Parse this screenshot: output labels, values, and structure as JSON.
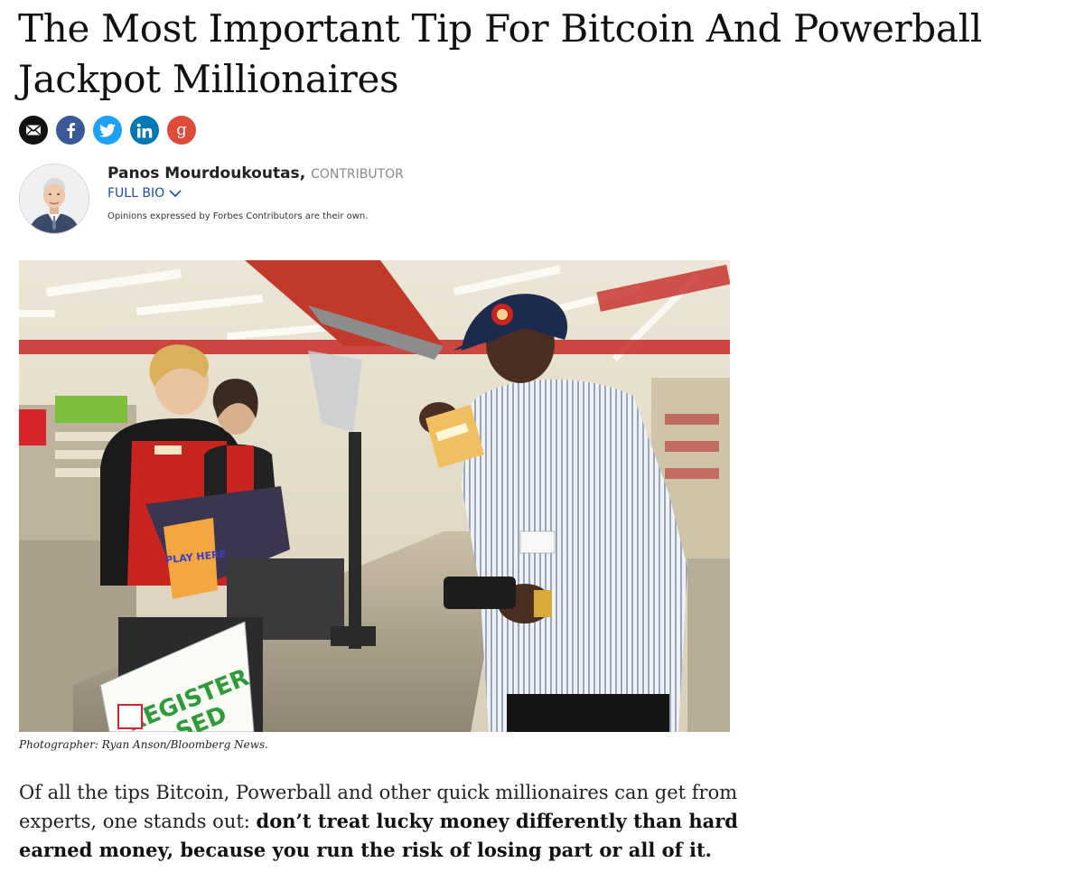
{
  "article": {
    "title": "The Most Important Tip For Bitcoin And Powerball Jackpot Millionaires"
  },
  "share": {
    "buttons": [
      {
        "icon": "email-icon",
        "color": "#111111"
      },
      {
        "icon": "facebook-icon",
        "color": "#3b5998"
      },
      {
        "icon": "twitter-icon",
        "color": "#1da1f2"
      },
      {
        "icon": "linkedin-icon",
        "color": "#0077b5"
      },
      {
        "icon": "google-plus-icon",
        "color": "#dd4b39"
      }
    ]
  },
  "author": {
    "name": "Panos Mourdoukoutas",
    "separator": ", ",
    "role": "CONTRIBUTOR",
    "bio_link": "FULL BIO",
    "disclaimer": "Opinions expressed by Forbes Contributors are their own."
  },
  "photo": {
    "sign_text": "PLAY HERE",
    "register_text": "REGISTER",
    "register_sub": "SED",
    "caption": "Photographer: Ryan Anson/Bloomberg News."
  },
  "body": {
    "intro": "Of all the tips Bitcoin, Powerball and other quick millionaires can get from experts, one stands out: ",
    "emphasis": "don’t treat lucky money differently than hard earned money, because you run the risk of losing part or all of it."
  },
  "colors": {
    "link": "#1a4e9f",
    "accent_red": "#c62a26"
  }
}
